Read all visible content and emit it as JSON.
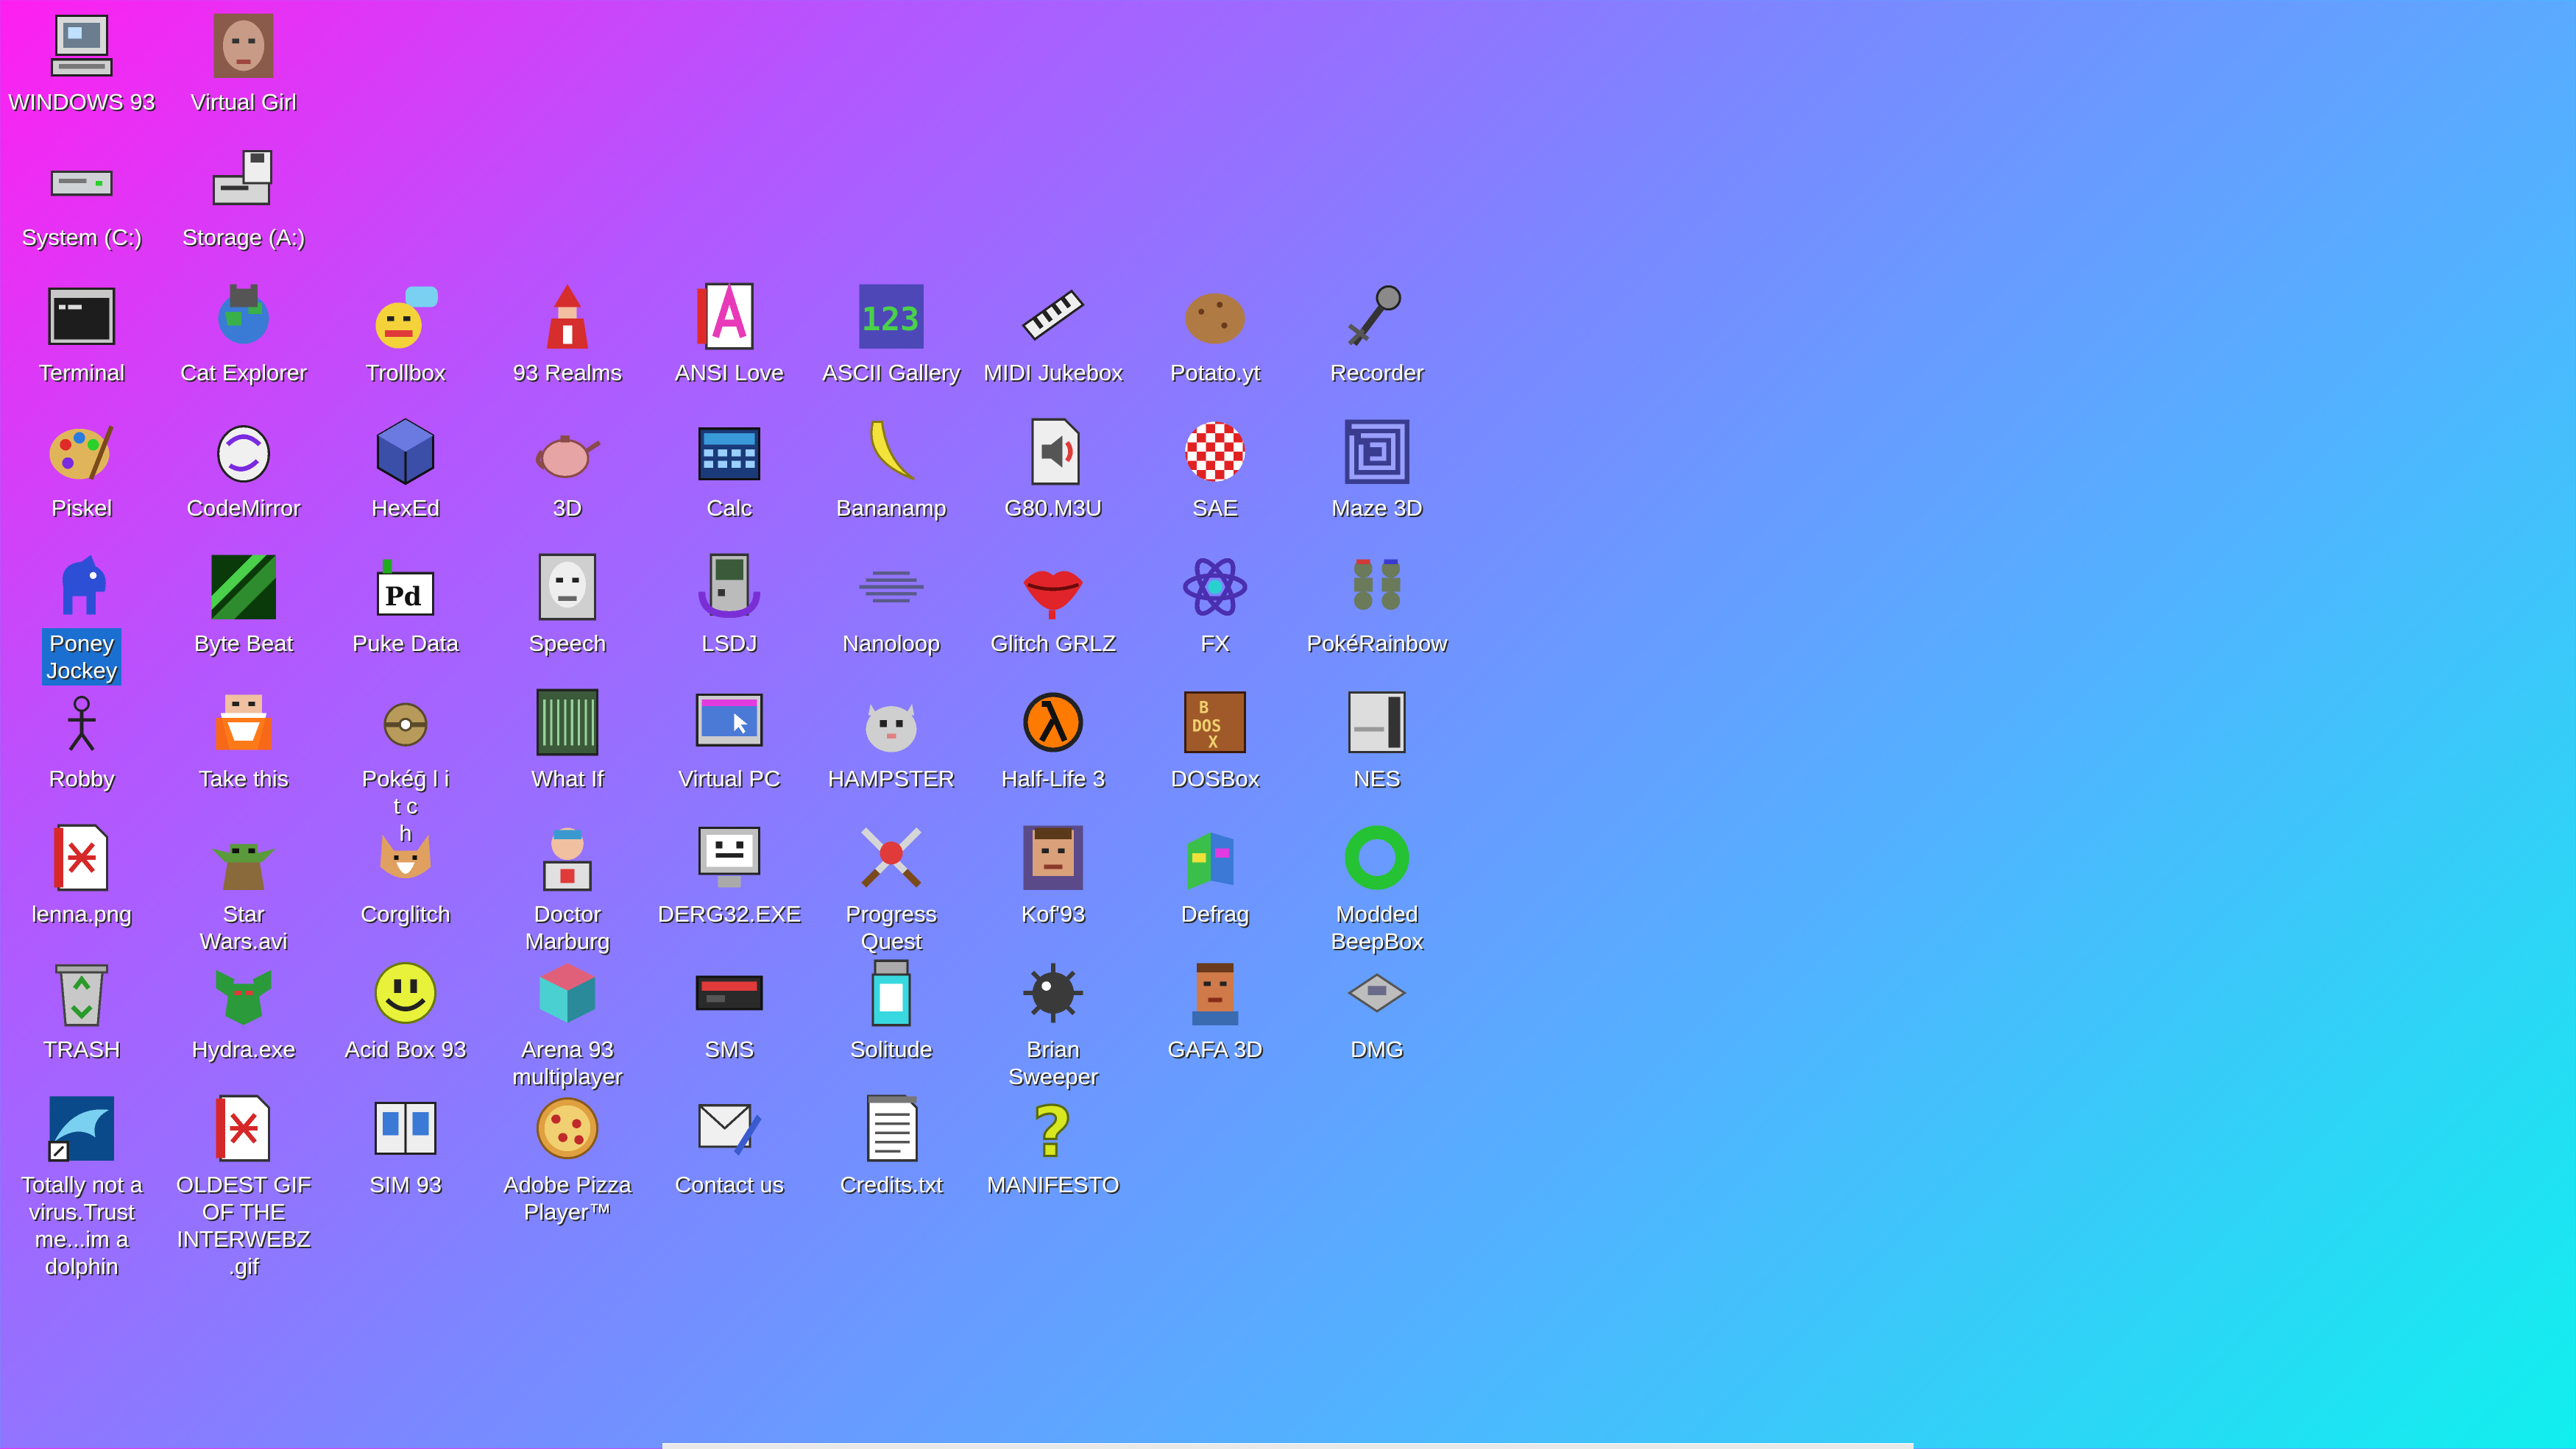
{
  "desktop": {
    "icons": [
      {
        "label": "WINDOWS 93",
        "icon": "computer-icon",
        "color": "#6b7d8f"
      },
      {
        "label": "Virtual Girl",
        "icon": "face-photo-icon",
        "color": "#c79b86"
      },
      {
        "label": "System (C:)",
        "icon": "hard-drive-icon",
        "color": "#cfd3d6"
      },
      {
        "label": "Storage (A:)",
        "icon": "floppy-drive-icon",
        "color": "#d6d6d6"
      },
      {
        "label": "Terminal",
        "icon": "terminal-icon",
        "color": "#1d1d1d"
      },
      {
        "label": "Cat Explorer",
        "icon": "globe-cat-icon",
        "color": "#3a7bd5"
      },
      {
        "label": "Trollbox",
        "icon": "troll-chat-icon",
        "color": "#f3d23a"
      },
      {
        "label": "93 Realms",
        "icon": "mage-icon",
        "color": "#d62d2d"
      },
      {
        "label": "ANSI Love",
        "icon": "ansi-letter-icon",
        "color": "#e83ab8"
      },
      {
        "label": "ASCII Gallery",
        "icon": "ascii-numbers-icon",
        "color": "#4ad04a"
      },
      {
        "label": "MIDI Jukebox",
        "icon": "piano-icon",
        "color": "#222222"
      },
      {
        "label": "Potato.yt",
        "icon": "potato-icon",
        "color": "#b07a45"
      },
      {
        "label": "Recorder",
        "icon": "microphone-icon",
        "color": "#8a8a8a"
      },
      {
        "label": "Piskel",
        "icon": "paint-palette-icon",
        "color": "#e0b55a"
      },
      {
        "label": "CodeMirror",
        "icon": "codemirror-icon",
        "color": "#f0f0f0"
      },
      {
        "label": "HexEd",
        "icon": "hex-cube-icon",
        "color": "#3b4ea8"
      },
      {
        "label": "3D",
        "icon": "teapot-icon",
        "color": "#e6a4a4"
      },
      {
        "label": "Calc",
        "icon": "calculator-icon",
        "color": "#3a9ad9"
      },
      {
        "label": "Bananamp",
        "icon": "banana-icon",
        "color": "#f2e23a"
      },
      {
        "label": "G80.M3U",
        "icon": "audio-file-icon",
        "color": "#eeeeee"
      },
      {
        "label": "SAE",
        "icon": "checker-ball-icon",
        "color": "#e22222"
      },
      {
        "label": "Maze 3D",
        "icon": "maze-icon",
        "color": "#3a3d8f"
      },
      {
        "label": "Poney\nJockey",
        "icon": "pony-icon",
        "color": "#2d4fd6",
        "selected": true
      },
      {
        "label": "Byte Beat",
        "icon": "byte-beat-icon",
        "color": "#2e8b2e"
      },
      {
        "label": "Puke Data",
        "icon": "pd-icon",
        "color": "#ffffff"
      },
      {
        "label": "Speech",
        "icon": "speech-face-icon",
        "color": "#cfcfcf"
      },
      {
        "label": "LSDJ",
        "icon": "gameboy-icon",
        "color": "#7a2fd6"
      },
      {
        "label": "Nanoloop",
        "icon": "nanoloop-icon",
        "color": "#5a5a8a"
      },
      {
        "label": "Glitch GRLZ",
        "icon": "lips-icon",
        "color": "#e0242a"
      },
      {
        "label": "FX",
        "icon": "atom-icon",
        "color": "#4a2fb0"
      },
      {
        "label": "PokéRainbow",
        "icon": "trainers-icon",
        "color": "#6a7a5a"
      },
      {
        "label": "Robby",
        "icon": "stick-figure-icon",
        "color": "#ffffff"
      },
      {
        "label": "Take this",
        "icon": "old-man-icon",
        "color": "#ff6a00"
      },
      {
        "label": "Pokéḡ     l   i\nt          c\nh",
        "icon": "glitch-pokeball-icon",
        "color": "#b89a5a"
      },
      {
        "label": "What If",
        "icon": "what-if-icon",
        "color": "#3a5a3a"
      },
      {
        "label": "Virtual PC",
        "icon": "virtual-pc-icon",
        "color": "#4a7ad6"
      },
      {
        "label": "HAMPSTER",
        "icon": "hamster-icon",
        "color": "#cfcfcf"
      },
      {
        "label": "Half-Life 3",
        "icon": "lambda-icon",
        "color": "#ff7a00"
      },
      {
        "label": "DOSBox",
        "icon": "dosbox-icon",
        "color": "#a05a2a"
      },
      {
        "label": "NES",
        "icon": "nes-console-icon",
        "color": "#dddddd"
      },
      {
        "label": "lenna.png",
        "icon": "image-file-icon",
        "color": "#d62828"
      },
      {
        "label": "Star\nWars.avi",
        "icon": "yoda-icon",
        "color": "#5a9a3a"
      },
      {
        "label": "Corglitch",
        "icon": "corgi-icon",
        "color": "#e0a060"
      },
      {
        "label": "Doctor\nMarburg",
        "icon": "doctor-icon",
        "color": "#e0e0e0"
      },
      {
        "label": "DERG32.EXE",
        "icon": "monitor-face-icon",
        "color": "#c0c0c0"
      },
      {
        "label": "Progress\nQuest",
        "icon": "crossed-swords-icon",
        "color": "#d6d6d6"
      },
      {
        "label": "Kof'93",
        "icon": "fighter-portrait-icon",
        "color": "#d9a07a"
      },
      {
        "label": "Defrag",
        "icon": "defrag-icon",
        "color": "#3ac04a"
      },
      {
        "label": "Modded\nBeepBox",
        "icon": "ring-icon",
        "color": "#25c234"
      },
      {
        "label": "TRASH",
        "icon": "recycle-bin-icon",
        "color": "#c8c8c8"
      },
      {
        "label": "Hydra.exe",
        "icon": "hydra-icon",
        "color": "#2a9a3a"
      },
      {
        "label": "Acid Box 93",
        "icon": "smiley-icon",
        "color": "#e8f23a"
      },
      {
        "label": "Arena 93\nmultiplayer",
        "icon": "cube-icon",
        "color": "#4ad0d0"
      },
      {
        "label": "SMS",
        "icon": "sms-console-icon",
        "color": "#2a2a2a"
      },
      {
        "label": "Solitude",
        "icon": "solitude-icon",
        "color": "#38d8e0"
      },
      {
        "label": "Brian\nSweeper",
        "icon": "mine-icon",
        "color": "#3a3a3a"
      },
      {
        "label": "GAFA 3D",
        "icon": "gafa-face-icon",
        "color": "#d07a4a"
      },
      {
        "label": "DMG",
        "icon": "dmg-cartridge-icon",
        "color": "#bdbdbd"
      },
      {
        "label": "Totally not a\nvirus.Trust\nme...im a\ndolphin",
        "icon": "dolphin-icon",
        "color": "#2a7ad0"
      },
      {
        "label": "OLDEST GIF\nOF THE\nINTERWEBZ\n.gif",
        "icon": "image-file-icon",
        "color": "#d62828"
      },
      {
        "label": "SIM 93",
        "icon": "sim-book-icon",
        "color": "#3a7ad6"
      },
      {
        "label": "Adobe Pizza\nPlayer™",
        "icon": "pizza-icon",
        "color": "#e0a040"
      },
      {
        "label": "Contact us",
        "icon": "contact-icon",
        "color": "#f0f0f0"
      },
      {
        "label": "Credits.txt",
        "icon": "text-file-icon",
        "color": "#ffffff"
      },
      {
        "label": "MANIFESTO",
        "icon": "question-mark-icon",
        "color": "#d8e820"
      }
    ]
  }
}
